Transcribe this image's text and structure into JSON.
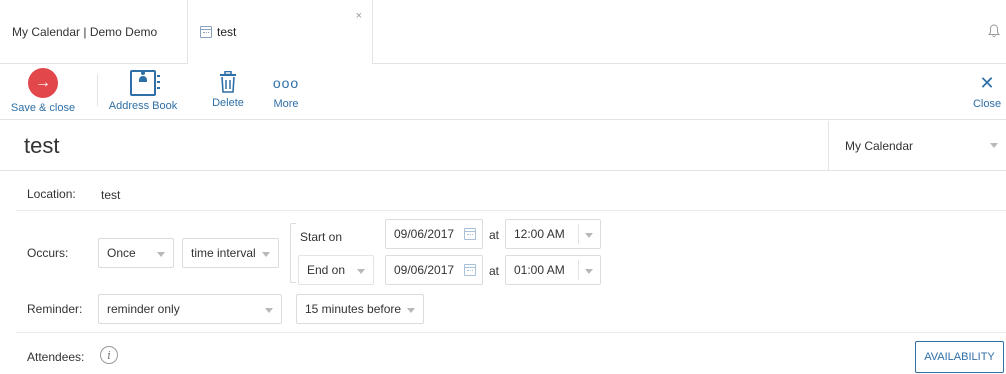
{
  "tabs": {
    "home_label": "My Calendar | Demo Demo",
    "active_label": "test",
    "close_glyph": "×"
  },
  "toolbar": {
    "save_label": "Save & close",
    "save_glyph": "→",
    "address_book_label": "Address Book",
    "delete_label": "Delete",
    "more_label": "More",
    "more_glyph": "ooo",
    "close_label": "Close",
    "close_glyph": "✕"
  },
  "event": {
    "title": "test",
    "calendar": "My Calendar"
  },
  "location": {
    "label": "Location:",
    "value": "test"
  },
  "occurs": {
    "label": "Occurs:",
    "frequency": "Once",
    "type": "time interval",
    "start_label": "Start on",
    "start_date": "09/06/2017",
    "start_time": "12:00 AM",
    "end_label": "End on",
    "end_date": "09/06/2017",
    "end_time": "01:00 AM",
    "at": "at"
  },
  "reminder": {
    "label": "Reminder:",
    "type": "reminder only",
    "when": "15 minutes before"
  },
  "attendees": {
    "label": "Attendees:",
    "info_glyph": "i",
    "availability_label": "AVAILABILITY"
  },
  "colors": {
    "accent": "#2e6fa7",
    "save": "#e2474b",
    "border": "#dcdcdc"
  },
  "icons": [
    "calendar-icon",
    "bell-icon",
    "arrow-right-icon",
    "address-book-icon",
    "trash-icon",
    "more-icon",
    "close-icon",
    "info-icon"
  ]
}
